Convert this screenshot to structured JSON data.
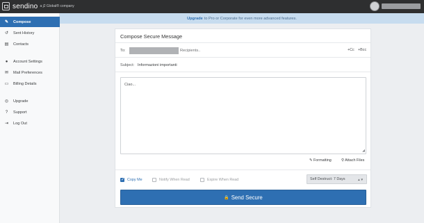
{
  "topbar": {
    "brand": "sendino",
    "brand_sub": "a j2 Global® company",
    "user_icon": "avatar-icon"
  },
  "sidebar": {
    "items": [
      {
        "label": "Compose",
        "icon": "pencil-icon",
        "glyph": "✎",
        "active": true
      },
      {
        "label": "Sent History",
        "icon": "history-icon",
        "glyph": "↺",
        "active": false
      },
      {
        "label": "Contacts",
        "icon": "contacts-icon",
        "glyph": "▤",
        "active": false
      },
      {
        "label": "Account Settings",
        "icon": "user-icon",
        "glyph": "●",
        "active": false
      },
      {
        "label": "Mail Preferences",
        "icon": "envelope-icon",
        "glyph": "✉",
        "active": false
      },
      {
        "label": "Billing Details",
        "icon": "credit-card-icon",
        "glyph": "▭",
        "active": false
      },
      {
        "label": "Upgrade",
        "icon": "lifebuoy-icon",
        "glyph": "◎",
        "active": false
      },
      {
        "label": "Support",
        "icon": "question-icon",
        "glyph": "?",
        "active": false
      },
      {
        "label": "Log Out",
        "icon": "logout-icon",
        "glyph": "⇥",
        "active": false
      }
    ]
  },
  "banner": {
    "link": "Upgrade",
    "text": "to Pro or Corporate for even more advanced features."
  },
  "compose": {
    "title": "Compose Secure Message",
    "to_label": "To:",
    "to_placeholder": "Recipients..",
    "cc_label": "+Cc",
    "bcc_label": "+Bcc",
    "subject_label": "Subject:",
    "subject_value": "Informazioni importanti",
    "message_value": "Ciao...",
    "formatting_label": "Formatting",
    "attach_label": "Attach Files",
    "copy_me_label": "Copy Me",
    "copy_me_checked": true,
    "notify_label": "Notify When Read",
    "notify_checked": false,
    "expire_label": "Expire When Read",
    "expire_checked": false,
    "self_destruct_value": "Self Destruct: 7 Days",
    "send_label": "Send Secure"
  },
  "colors": {
    "accent": "#2e6fb2",
    "topbar": "#2e2f30",
    "banner_bg": "#c7dcef"
  }
}
